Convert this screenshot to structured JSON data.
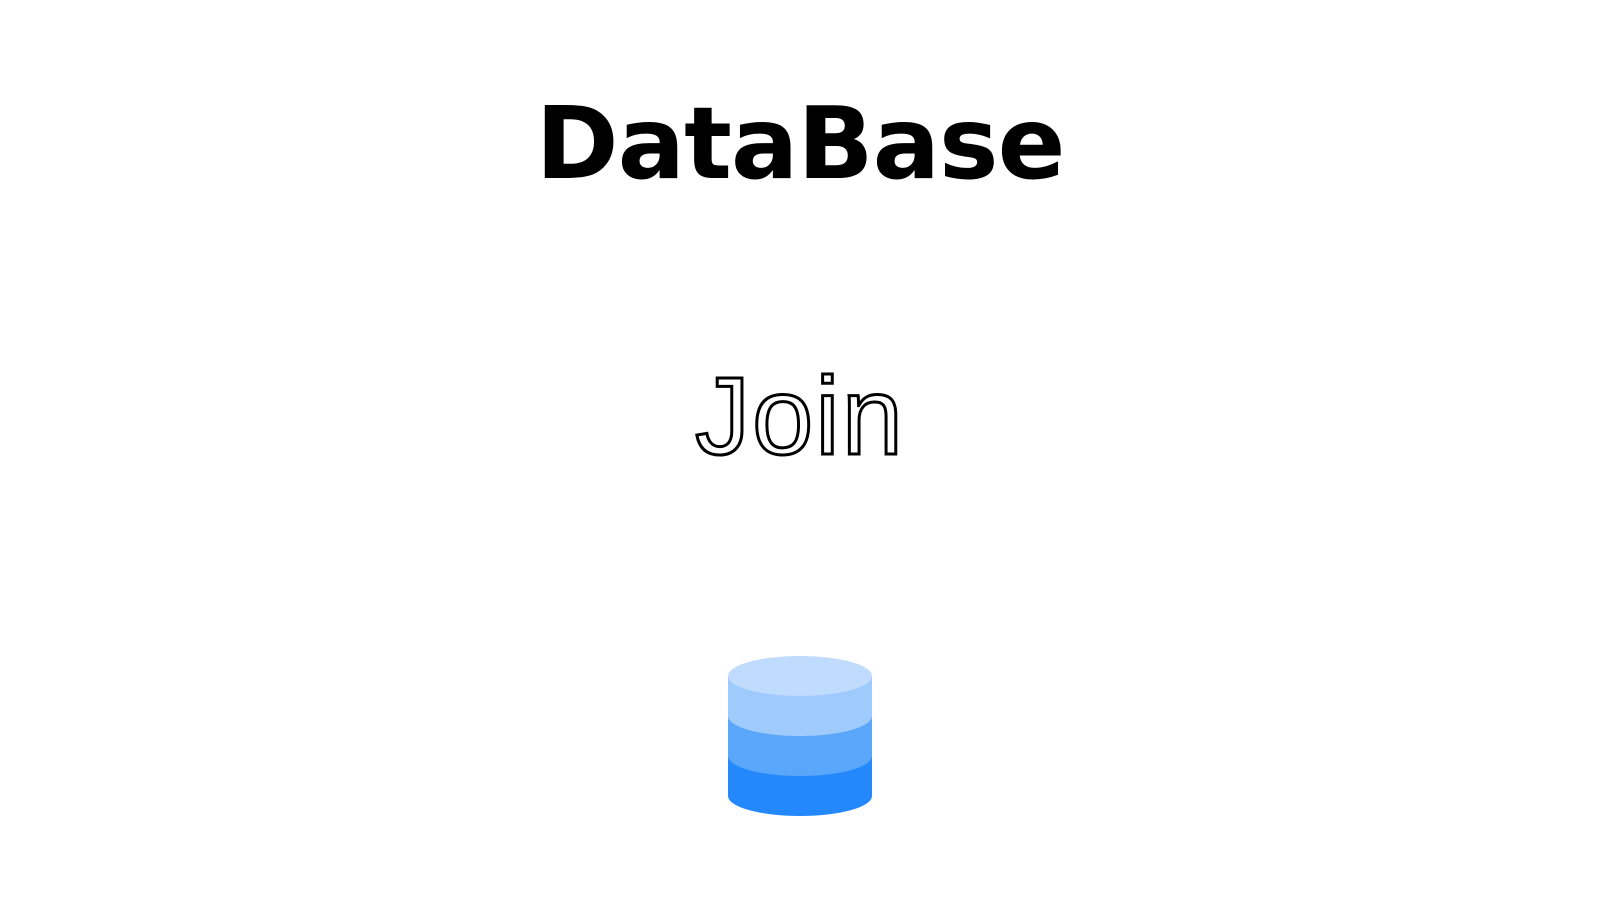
{
  "slide": {
    "title": "DataBase",
    "subtitle": "Join",
    "icon": "database-icon"
  },
  "colors": {
    "background": "#ffffff",
    "text": "#000000",
    "icon_top": "#bfdbfe",
    "icon_layer_1": "#9fcafc",
    "icon_layer_2": "#5aa6fb",
    "icon_layer_3": "#2388fb"
  }
}
